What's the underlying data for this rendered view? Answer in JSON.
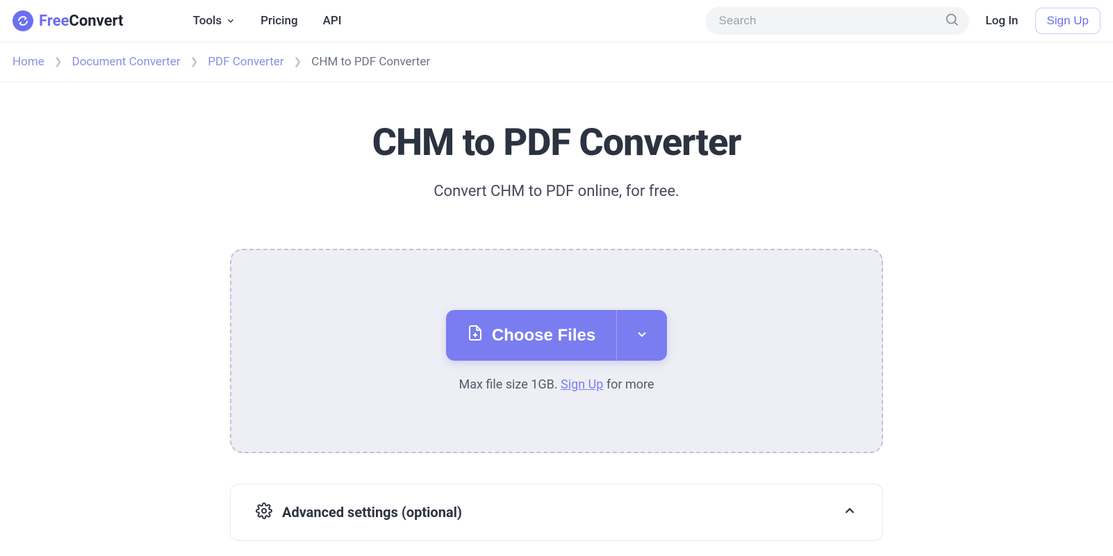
{
  "logo": {
    "free": "Free",
    "convert": "Convert"
  },
  "nav": {
    "tools": "Tools",
    "pricing": "Pricing",
    "api": "API"
  },
  "search": {
    "placeholder": "Search"
  },
  "auth": {
    "login": "Log In",
    "signup": "Sign Up"
  },
  "breadcrumb": {
    "home": "Home",
    "doc": "Document Converter",
    "pdf": "PDF Converter",
    "current": "CHM to PDF Converter"
  },
  "page": {
    "title": "CHM to PDF Converter",
    "subtitle": "Convert CHM to PDF online, for free."
  },
  "dropzone": {
    "choose": "Choose Files",
    "note_pre": "Max file size 1GB. ",
    "note_link": "Sign Up",
    "note_post": " for more"
  },
  "advanced": {
    "title": "Advanced settings (optional)"
  }
}
